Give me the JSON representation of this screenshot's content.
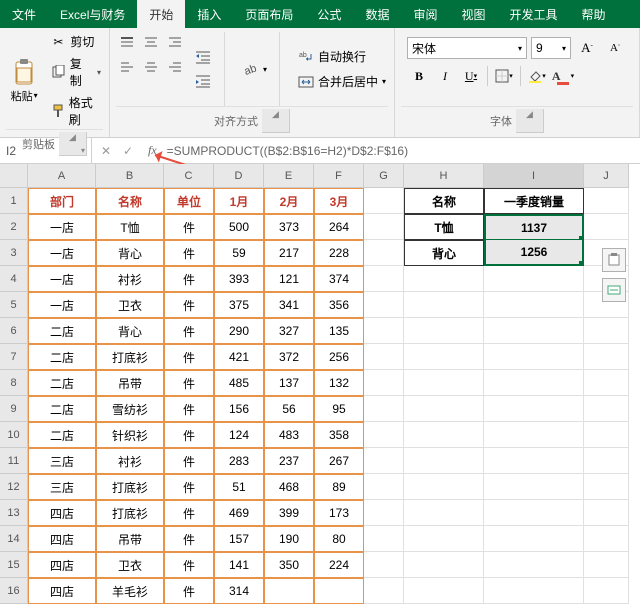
{
  "tabs": [
    "文件",
    "Excel与财务",
    "开始",
    "插入",
    "页面布局",
    "公式",
    "数据",
    "审阅",
    "视图",
    "开发工具",
    "帮助"
  ],
  "active_tab_idx": 2,
  "ribbon": {
    "clipboard": {
      "label": "剪贴板",
      "paste": "粘贴",
      "cut": "剪切",
      "copy": "复制",
      "format_painter": "格式刷"
    },
    "align": {
      "label": "对齐方式",
      "wrap": "自动换行",
      "merge": "合并后居中"
    },
    "font": {
      "label": "字体",
      "name": "宋体",
      "size": "9"
    }
  },
  "namebox": "I2",
  "formula": "=SUMPRODUCT((B$2:B$16=H2)*D$2:F$16)",
  "cols": [
    "A",
    "B",
    "C",
    "D",
    "E",
    "F",
    "G",
    "H",
    "I",
    "J"
  ],
  "main_headers": [
    "部门",
    "名称",
    "单位",
    "1月",
    "2月",
    "3月"
  ],
  "side_headers": [
    "名称",
    "一季度销量"
  ],
  "chart_data": {
    "type": "table",
    "main": [
      [
        "一店",
        "T恤",
        "件",
        "500",
        "373",
        "264"
      ],
      [
        "一店",
        "背心",
        "件",
        "59",
        "217",
        "228"
      ],
      [
        "一店",
        "衬衫",
        "件",
        "393",
        "121",
        "374"
      ],
      [
        "一店",
        "卫衣",
        "件",
        "375",
        "341",
        "356"
      ],
      [
        "二店",
        "背心",
        "件",
        "290",
        "327",
        "135"
      ],
      [
        "二店",
        "打底衫",
        "件",
        "421",
        "372",
        "256"
      ],
      [
        "二店",
        "吊带",
        "件",
        "485",
        "137",
        "132"
      ],
      [
        "二店",
        "雪纺衫",
        "件",
        "156",
        "56",
        "95"
      ],
      [
        "二店",
        "针织衫",
        "件",
        "124",
        "483",
        "358"
      ],
      [
        "三店",
        "衬衫",
        "件",
        "283",
        "237",
        "267"
      ],
      [
        "三店",
        "打底衫",
        "件",
        "51",
        "468",
        "89"
      ],
      [
        "四店",
        "打底衫",
        "件",
        "469",
        "399",
        "173"
      ],
      [
        "四店",
        "吊带",
        "件",
        "157",
        "190",
        "80"
      ],
      [
        "四店",
        "卫衣",
        "件",
        "141",
        "350",
        "224"
      ],
      [
        "四店",
        "羊毛衫",
        "件",
        "314",
        "",
        ""
      ]
    ],
    "side": [
      [
        "T恤",
        "1137"
      ],
      [
        "背心",
        "1256"
      ]
    ]
  },
  "row_nums": [
    "1",
    "2",
    "3",
    "4",
    "5",
    "6",
    "7",
    "8",
    "9",
    "10",
    "11",
    "12",
    "13",
    "14",
    "15",
    "16"
  ]
}
